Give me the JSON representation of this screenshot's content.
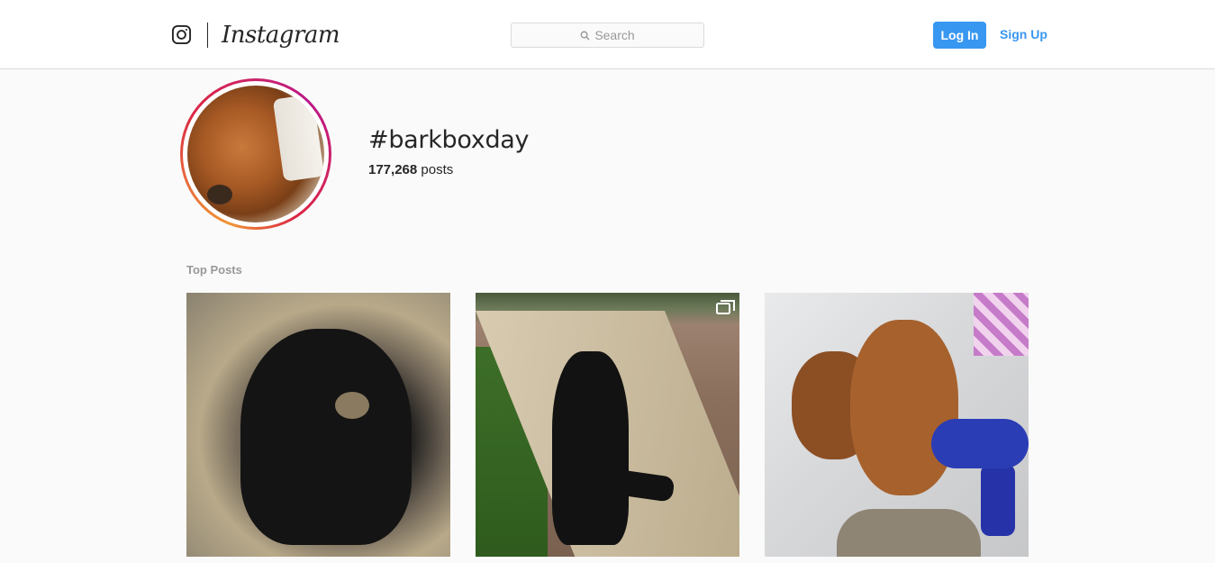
{
  "header": {
    "brand_wordmark": "Instagram",
    "search_placeholder": "Search",
    "login_label": "Log In",
    "signup_label": "Sign Up"
  },
  "profile": {
    "hashtag": "#barkboxday",
    "post_count": "177,268",
    "post_count_suffix": "posts"
  },
  "section": {
    "top_posts_label": "Top Posts"
  },
  "posts": [
    {
      "subject": "wet black cocker spaniel puppy on sand"
    },
    {
      "subject": "black dog resting on stone wall",
      "carousel_icon": "carousel-icon"
    },
    {
      "subject": "two griffon dogs next to blue hair dryer"
    }
  ],
  "colors": {
    "accent": "#3897f0",
    "text": "#262626",
    "muted": "#999999",
    "border": "#dbdbdb"
  },
  "icons": [
    "instagram-glyph-icon",
    "search-icon",
    "carousel-icon"
  ]
}
